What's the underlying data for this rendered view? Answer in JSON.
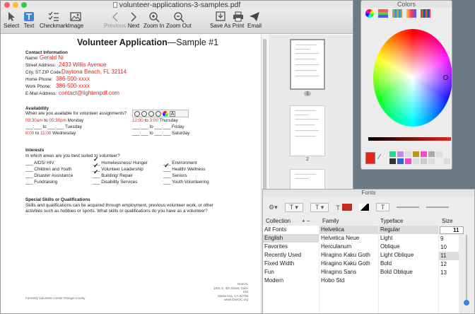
{
  "window": {
    "title": "volunteer-applications-3-samples.pdf"
  },
  "toolbar": {
    "select": "Select",
    "text": "Text",
    "checkmark": "Checkmark",
    "image": "Image",
    "previous": "Previous",
    "next": "Next",
    "zoom_in": "Zoom In",
    "zoom_out": "Zoom Out",
    "save_as": "Save As",
    "print": "Print",
    "email": "Email"
  },
  "form": {
    "title_bold": "Volunteer Application",
    "title_rest": "—Sample #1",
    "contact": {
      "heading": "Contact Information",
      "name_label": "Name:",
      "name": "Gerald Ni",
      "street_label": "Street Address:",
      "street": "2433 Willis Avenue",
      "city_label": "City, ST ZIP Code:",
      "city": "Daytona Beach, FL 32114",
      "home_label": "Home Phone:",
      "home": "386-500-xxxx",
      "work_label": "Work Phone:",
      "work": "386-500-xxxx",
      "email_label": "E-Mail Address:",
      "email": "contact@lightenpdf.com"
    },
    "availability": {
      "heading": "Availability",
      "question": "When are you available for volunteer assignments?",
      "mon": {
        "from": "09",
        "from_m": "30am",
        "to": "05",
        "to_m": "30pm",
        "day": "Monday"
      },
      "tue": {
        "from": "___:___",
        "to": "___:___",
        "day": "Tuesday"
      },
      "wed": {
        "from": "8",
        "from_m": "00",
        "to": "11",
        "to_m": "00",
        "day": "Wednesday"
      },
      "thu": {
        "from": "12",
        "from_m": "00",
        "to": "3",
        "to_m": "00",
        "day": "Thursday"
      },
      "fri": {
        "day": "Friday"
      },
      "sat": {
        "day": "Saturday"
      },
      "to_word": "to"
    },
    "interests": {
      "heading": "Interests",
      "question": "In which areas are you best suited to volunteer?",
      "items": [
        "AIDS/ HIV",
        "Homelessness/ Hunger",
        "Environment",
        "Children and Youth",
        "Volunteer Leadership",
        "Health/ Wellness",
        "Disaster Assistance",
        "Building/ Repair",
        "Seniors",
        "Fundraising",
        "Disability Services",
        "Youth Volunteering"
      ]
    },
    "skills": {
      "heading": "Special Skills or Qualifications",
      "line1": "Skills and qualifications can be acquired through employment, previous volunteer work, or other",
      "line2": "activities such as hobbies or sports. What skills or qualifications do you have as a volunteer?"
    },
    "footer_left": "Formerly Volunteer Center Orange County",
    "footer_right": [
      "OneOC",
      "1901 E. 4th Street, Suite 100",
      "Santa Ana, CA 92705",
      "www.OneOC.org"
    ]
  },
  "thumbnails": {
    "pages": [
      "1",
      "2"
    ]
  },
  "colors_panel": {
    "title": "Colors",
    "accent": "#e0261c"
  },
  "fonts_panel": {
    "title": "Fonts",
    "size_value": "11",
    "headers": {
      "collection": "Collection",
      "family": "Family",
      "typeface": "Typeface",
      "size": "Size"
    },
    "collections": [
      "All Fonts",
      "English",
      "Favorites",
      "Recently Used",
      "Fixed Width",
      "Fun",
      "Modern"
    ],
    "families": [
      "Helvetica",
      "Helvetica Neue",
      "Herculanum",
      "Hiragino Kaku Goth",
      "Hiragino Kaku Goth",
      "Hiragino Sans",
      "Hobo Std"
    ],
    "typefaces": [
      "Regular",
      "Light",
      "Oblique",
      "Light Oblique",
      "Bold",
      "Bold Oblique"
    ],
    "sizes": [
      "9",
      "10",
      "11",
      "12",
      "13"
    ]
  }
}
